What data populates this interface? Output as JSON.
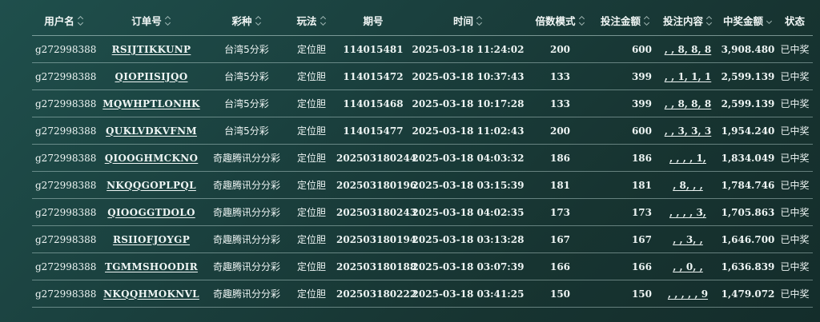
{
  "table": {
    "headers": [
      {
        "key": "user",
        "label": "用户名",
        "sort": "both"
      },
      {
        "key": "order",
        "label": "订单号",
        "sort": "both"
      },
      {
        "key": "lottery",
        "label": "彩种",
        "sort": "both"
      },
      {
        "key": "play",
        "label": "玩法",
        "sort": "both"
      },
      {
        "key": "issue",
        "label": "期号",
        "sort": "none"
      },
      {
        "key": "time",
        "label": "时间",
        "sort": "both"
      },
      {
        "key": "multiplier",
        "label": "倍数模式",
        "sort": "both"
      },
      {
        "key": "bet_amount",
        "label": "投注金额",
        "sort": "both"
      },
      {
        "key": "bet_content",
        "label": "投注内容",
        "sort": "both"
      },
      {
        "key": "win_amount",
        "label": "中奖金额",
        "sort": "down"
      },
      {
        "key": "status",
        "label": "状态",
        "sort": "none"
      }
    ],
    "rows": [
      {
        "user": "g272998388",
        "order": "RSIJTIKKUNP",
        "lottery": "台湾5分彩",
        "play": "定位胆",
        "issue": "114015481",
        "time": "2025-03-18 11:24:02",
        "multiplier": "200",
        "bet_amount": "600",
        "bet_content": ", , 8, 8, 8",
        "win_amount": "3,908.480",
        "status": "已中奖"
      },
      {
        "user": "g272998388",
        "order": "QIOPIISIJQO",
        "lottery": "台湾5分彩",
        "play": "定位胆",
        "issue": "114015472",
        "time": "2025-03-18 10:37:43",
        "multiplier": "133",
        "bet_amount": "399",
        "bet_content": ", , 1, 1, 1",
        "win_amount": "2,599.139",
        "status": "已中奖"
      },
      {
        "user": "g272998388",
        "order": "MQWHPTLONHK",
        "lottery": "台湾5分彩",
        "play": "定位胆",
        "issue": "114015468",
        "time": "2025-03-18 10:17:28",
        "multiplier": "133",
        "bet_amount": "399",
        "bet_content": ", , 8, 8, 8",
        "win_amount": "2,599.139",
        "status": "已中奖"
      },
      {
        "user": "g272998388",
        "order": "QUKLVDKVFNM",
        "lottery": "台湾5分彩",
        "play": "定位胆",
        "issue": "114015477",
        "time": "2025-03-18 11:02:43",
        "multiplier": "200",
        "bet_amount": "600",
        "bet_content": ", , 3, 3, 3",
        "win_amount": "1,954.240",
        "status": "已中奖"
      },
      {
        "user": "g272998388",
        "order": "QIOOGHMCKNO",
        "lottery": "奇趣腾讯分分彩",
        "play": "定位胆",
        "issue": "202503180244",
        "time": "2025-03-18 04:03:32",
        "multiplier": "186",
        "bet_amount": "186",
        "bet_content": ", , , , 1,",
        "win_amount": "1,834.049",
        "status": "已中奖"
      },
      {
        "user": "g272998388",
        "order": "NKQQGOPLPQL",
        "lottery": "奇趣腾讯分分彩",
        "play": "定位胆",
        "issue": "202503180196",
        "time": "2025-03-18 03:15:39",
        "multiplier": "181",
        "bet_amount": "181",
        "bet_content": ", 8, , ,",
        "win_amount": "1,784.746",
        "status": "已中奖"
      },
      {
        "user": "g272998388",
        "order": "QIOOGGTDOLO",
        "lottery": "奇趣腾讯分分彩",
        "play": "定位胆",
        "issue": "202503180243",
        "time": "2025-03-18 04:02:35",
        "multiplier": "173",
        "bet_amount": "173",
        "bet_content": ", , , , 3,",
        "win_amount": "1,705.863",
        "status": "已中奖"
      },
      {
        "user": "g272998388",
        "order": "RSIIOFJOYGP",
        "lottery": "奇趣腾讯分分彩",
        "play": "定位胆",
        "issue": "202503180194",
        "time": "2025-03-18 03:13:28",
        "multiplier": "167",
        "bet_amount": "167",
        "bet_content": ", , 3, ,",
        "win_amount": "1,646.700",
        "status": "已中奖"
      },
      {
        "user": "g272998388",
        "order": "TGMMSHOODIR",
        "lottery": "奇趣腾讯分分彩",
        "play": "定位胆",
        "issue": "202503180188",
        "time": "2025-03-18 03:07:39",
        "multiplier": "166",
        "bet_amount": "166",
        "bet_content": ", , 0, ,",
        "win_amount": "1,636.839",
        "status": "已中奖"
      },
      {
        "user": "g272998388",
        "order": "NKQQHMOKNVL",
        "lottery": "奇趣腾讯分分彩",
        "play": "定位胆",
        "issue": "202503180222",
        "time": "2025-03-18 03:41:25",
        "multiplier": "150",
        "bet_amount": "150",
        "bet_content": ", , , , , 9",
        "win_amount": "1,479.072",
        "status": "已中奖"
      }
    ]
  }
}
